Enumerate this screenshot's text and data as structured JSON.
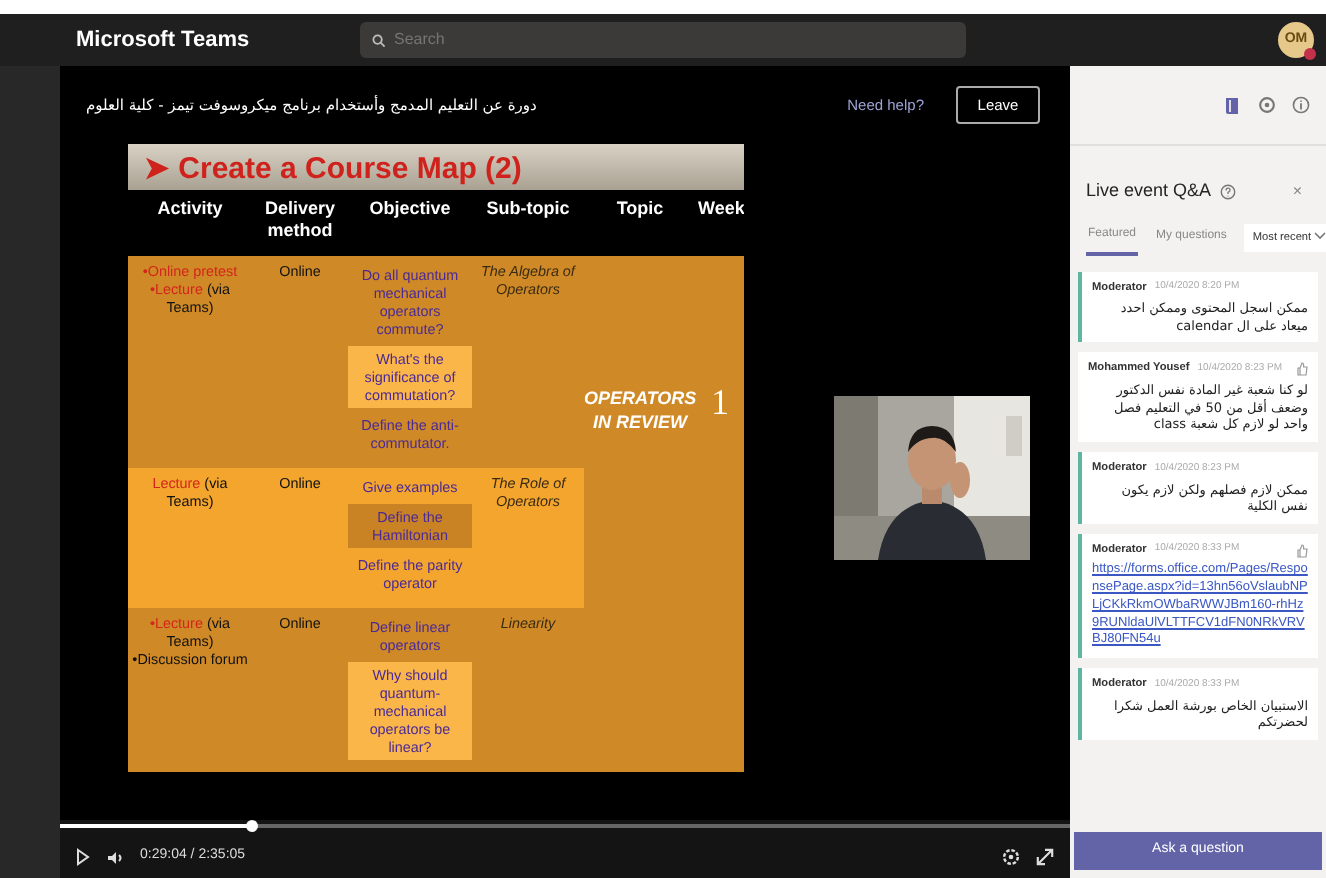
{
  "app": {
    "title": "Microsoft Teams",
    "search_placeholder": "Search",
    "avatar": "OM"
  },
  "event": {
    "title": "دورة عن التعليم المدمج وأستخدام برنامج ميكروسوفت تيمز - كلية العلوم",
    "help": "Need help?",
    "leave": "Leave"
  },
  "slide": {
    "marker": "➤",
    "title": "Create a Course Map (2)",
    "columns": [
      "Activity",
      "Delivery method",
      "Objective",
      "Sub-topic",
      "Topic",
      "Week"
    ],
    "rows": [
      {
        "color": "#cf8a27",
        "activity": [
          [
            {
              "text": "•Online pretest",
              "red": true
            }
          ],
          [
            {
              "text": "•Lecture",
              "red": true
            },
            {
              "text": " (via Teams)",
              "red": false
            }
          ]
        ],
        "delivery": "Online",
        "objectives": [
          {
            "text": "Do all quantum mechanical operators commute?",
            "highlighted": false
          },
          {
            "text": "What's the significance of commutation?",
            "highlighted": true,
            "color": "#fbb64a"
          },
          {
            "text": "Define the anti-commutator.",
            "highlighted": false
          }
        ],
        "subtopic": "The Algebra of Operators"
      },
      {
        "color": "#f3a52d",
        "activity": [
          [
            {
              "text": "Lecture",
              "red": true
            },
            {
              "text": " (via Teams)",
              "red": false
            }
          ]
        ],
        "delivery": "Online",
        "objectives": [
          {
            "text": "Give examples",
            "highlighted": false
          },
          {
            "text": "Define the Hamiltonian",
            "highlighted": true,
            "color": "#c98325"
          },
          {
            "text": "Define the parity operator",
            "highlighted": false
          }
        ],
        "subtopic": "The Role of Operators"
      },
      {
        "color": "#cf8a27",
        "activity": [
          [
            {
              "text": "•Lecture",
              "red": true
            },
            {
              "text": " (via Teams)",
              "red": false
            }
          ],
          [
            {
              "text": "•Discussion forum",
              "red": false
            }
          ]
        ],
        "delivery": "Online",
        "objectives": [
          {
            "text": "Define linear operators",
            "highlighted": false
          },
          {
            "text": "Why should quantum-mechanical operators be linear?",
            "highlighted": true,
            "color": "#fbb64a"
          }
        ],
        "subtopic": "Linearity"
      }
    ],
    "topic": "OPERATORS IN REVIEW",
    "week": "1"
  },
  "playback": {
    "level": 0.19,
    "time": "0:29:04 / 2:35:05"
  },
  "qa": {
    "title": "Live event Q&A",
    "close": "×",
    "tabs": [
      {
        "label": "Featured",
        "selected": true
      },
      {
        "label": "My questions",
        "selected": false
      }
    ],
    "sort": "Most recent",
    "messages": [
      {
        "kind": "moderator",
        "author": "Moderator",
        "time": "10/4/2020 8:20 PM",
        "liked": false,
        "is_link": false,
        "body": "ممكن اسجل المحتوى وممكن احدد ميعاد على ال calendar"
      },
      {
        "kind": "attendee",
        "author": "Mohammed Yousef",
        "time": "10/4/2020 8:23 PM",
        "liked": true,
        "is_link": false,
        "body": "لو كنا شعبة غير المادة نفس الدكتور وضعف أقل من 50 في التعليم فصل واحد لو لازم كل شعبة class"
      },
      {
        "kind": "moderator",
        "author": "Moderator",
        "time": "10/4/2020 8:23 PM",
        "liked": false,
        "is_link": false,
        "body": "ممكن لازم فصلهم ولكن لازم يكون نفس الكلية"
      },
      {
        "kind": "moderator",
        "author": "Moderator",
        "time": "10/4/2020 8:33 PM",
        "liked": true,
        "is_link": true,
        "body": "https://forms.office.com/Pages/ResponsePage.aspx?id=13hn56oVslaubNPLjCKkRkmOWbaRWWJBm160-rhHz9RUNldaUlVLTTFCV1dFN0NRkVRVBJ80FN54u"
      },
      {
        "kind": "moderator",
        "author": "Moderator",
        "time": "10/4/2020 8:33 PM",
        "liked": false,
        "is_link": false,
        "body": "الاستبيان الخاص بورشة العمل شكرا لحضرتكم"
      }
    ],
    "ask": "Ask a question"
  }
}
